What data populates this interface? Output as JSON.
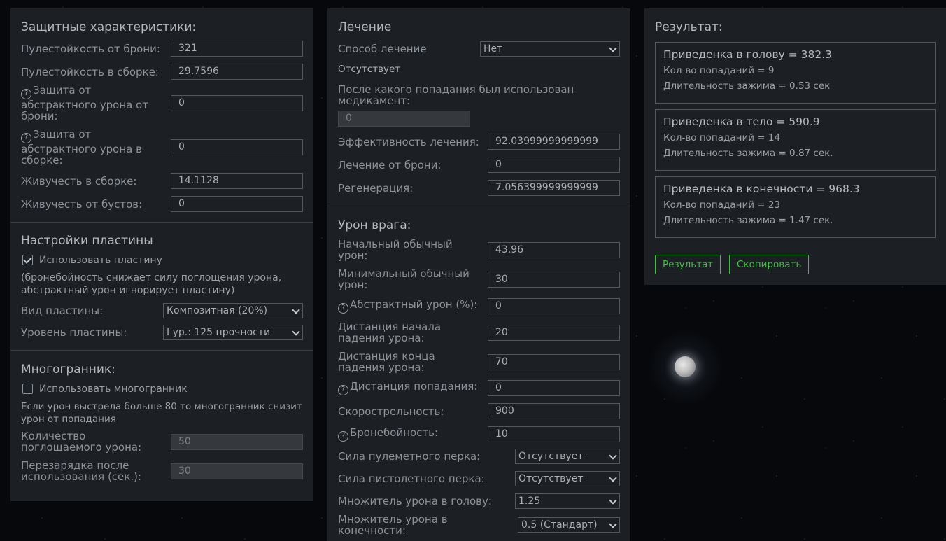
{
  "defense": {
    "title": "Защитные характеристики:",
    "armor_bullet_label": "Пулестойкость от брони:",
    "armor_bullet_value": "321",
    "build_bullet_label": "Пулестойкость в сборке:",
    "build_bullet_value": "29.7596",
    "abstract_armor_label": "Защита от абстрактного урона от брони:",
    "abstract_armor_value": "0",
    "abstract_build_label": "Защита от абстрактного урона в сборке:",
    "abstract_build_value": "0",
    "vitality_build_label": "Живучесть в сборке:",
    "vitality_build_value": "14.1128",
    "vitality_boost_label": "Живучесть от бустов:",
    "vitality_boost_value": "0"
  },
  "plate": {
    "title": "Настройки пластины",
    "use_label": "Использовать пластину",
    "use_checked": true,
    "note": "(бронебойность снижает силу поглощения урона, абстрактный урон игнорирует пластину)",
    "type_label": "Вид пластины:",
    "type_value": "Композитная (20%)",
    "level_label": "Уровень пластины:",
    "level_value": "I ур.: 125 прочности"
  },
  "poly": {
    "title": "Многогранник:",
    "use_label": "Использовать многогранник",
    "use_checked": false,
    "note": "Если урон выстрела больше 80 то многогранник снизит урон от попадания",
    "absorb_label": "Количество поглощаемого урона:",
    "absorb_value": "50",
    "reload_label": "Перезарядка после использования (сек.):",
    "reload_value": "30"
  },
  "heal": {
    "title": "Лечение",
    "method_label": "Способ лечение",
    "method_value": "Нет",
    "status": "Отсутствует",
    "after_hit_label": "После какого попадания был использован медикамент:",
    "after_hit_value": "0",
    "efficiency_label": "Эффективность лечения:",
    "efficiency_value": "92.03999999999999",
    "armor_heal_label": "Лечение от брони:",
    "armor_heal_value": "0",
    "regen_label": "Регенерация:",
    "regen_value": "7.056399999999999"
  },
  "enemy": {
    "title": "Урон врага:",
    "initial_label": "Начальный обычный урон:",
    "initial_value": "43.96",
    "min_label": "Минимальный обычный урон:",
    "min_value": "30",
    "abstract_label": "Абстрактный урон (%):",
    "abstract_value": "0",
    "falloff_start_label": "Дистанция начала падения урона:",
    "falloff_start_value": "20",
    "falloff_end_label": "Дистанция конца падения урона:",
    "falloff_end_value": "70",
    "hit_dist_label": "Дистанция попадания:",
    "hit_dist_value": "0",
    "rate_label": "Скорострельность:",
    "rate_value": "900",
    "pierce_label": "Бронебойность:",
    "pierce_value": "10",
    "mg_perk_label": "Сила пулеметного перка:",
    "mg_perk_value": "Отсутствует",
    "pistol_perk_label": "Сила пистолетного перка:",
    "pistol_perk_value": "Отсутствует",
    "head_mult_label": "Множитель урона в голову:",
    "head_mult_value": "1.25",
    "limb_mult_label": "Множитель урона в конечности:",
    "limb_mult_value": "0.5 (Стандарт)"
  },
  "result": {
    "title": "Результат:",
    "boxes": [
      {
        "title": "Приведенка в голову = 382.3",
        "hits": "Кол-во попаданий = 9",
        "hold": "Длительность зажима = 0.53 сек"
      },
      {
        "title": "Приведенка в тело = 590.9",
        "hits": "Кол-во попаданий = 14",
        "hold": "Длительность зажима = 0.87 сек."
      },
      {
        "title": "Приведенка в конечности = 968.3",
        "hits": "Кол-во попаданий = 23",
        "hold": "Длительность зажима = 1.47 сек."
      }
    ],
    "result_button": "Результат",
    "copy_button": "Скопировать",
    "accent_color": "#3fbf3f"
  }
}
